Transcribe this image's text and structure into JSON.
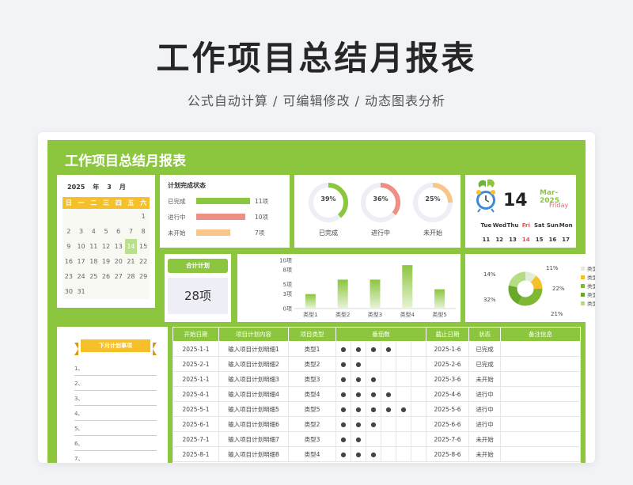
{
  "hero": {
    "title": "工作项目总结月报表",
    "subtitle": "公式自动计算 /  可编辑修改  / 动态图表分析"
  },
  "sheet_title": "工作项目总结月报表",
  "calendar": {
    "year": "2025",
    "year_unit": "年",
    "month": "3",
    "month_unit": "月",
    "weekdays": [
      "日",
      "一",
      "二",
      "三",
      "四",
      "五",
      "六"
    ],
    "days": [
      "",
      "",
      "",
      "",
      "",
      "",
      "1",
      "2",
      "3",
      "4",
      "5",
      "6",
      "7",
      "8",
      "9",
      "10",
      "11",
      "12",
      "13",
      "14",
      "15",
      "16",
      "17",
      "18",
      "19",
      "20",
      "21",
      "22",
      "23",
      "24",
      "25",
      "26",
      "27",
      "28",
      "29",
      "30",
      "31"
    ],
    "today": "14"
  },
  "plan_status": {
    "title": "计划完成状态",
    "rows": [
      {
        "label": "已完成",
        "count": "11项",
        "value": 11,
        "color": "#8cc63f"
      },
      {
        "label": "进行中",
        "count": "10项",
        "value": 10,
        "color": "#ee8f86"
      },
      {
        "label": "未开始",
        "count": "7项",
        "value": 7,
        "color": "#f8c68a"
      }
    ]
  },
  "donuts": [
    {
      "label": "已完成",
      "pct_text": "39%",
      "pct": 39,
      "color": "#8cc63f"
    },
    {
      "label": "进行中",
      "pct_text": "36%",
      "pct": 36,
      "color": "#ee8f86"
    },
    {
      "label": "未开始",
      "pct_text": "25%",
      "pct": 25,
      "color": "#f8c68a"
    }
  ],
  "date_widget": {
    "day": "14",
    "month_year": "Mar-2025",
    "weekday": "Friday",
    "week_names": [
      "Tue",
      "Wed",
      "Thu",
      "Fri",
      "Sat",
      "Sun",
      "Mon"
    ],
    "week_nums": [
      "11",
      "12",
      "13",
      "14",
      "15",
      "16",
      "17"
    ]
  },
  "total": {
    "label": "合计计划",
    "value": "28项"
  },
  "chart_data": [
    {
      "type": "bar",
      "categories": [
        "类型1",
        "类型2",
        "类型3",
        "类型4",
        "类型5"
      ],
      "values": [
        3,
        6,
        6,
        9,
        4
      ],
      "ylim": [
        0,
        10
      ],
      "yticks": [
        "0项",
        "3项",
        "5项",
        "8项",
        "10项"
      ],
      "ytick_values": [
        0,
        3,
        5,
        8,
        10
      ],
      "color": "#8cc63f"
    },
    {
      "type": "pie",
      "categories": [
        "类型1",
        "类型2",
        "类型3",
        "类型4",
        "类型5"
      ],
      "values": [
        11,
        14,
        32,
        21,
        22
      ],
      "labels": [
        "11%",
        "14%",
        "32%",
        "21%",
        "22%"
      ],
      "colors": [
        "#e2ecd6",
        "#f6c02a",
        "#7fb833",
        "#6aa82a",
        "#b4dc82"
      ]
    }
  ],
  "next_month": {
    "title": "下月计划事项",
    "items": [
      "1、",
      "2、",
      "3、",
      "4、",
      "5、",
      "6、",
      "7、"
    ]
  },
  "table": {
    "headers": [
      "开始日期",
      "项目计划内容",
      "项目类型",
      "番茄数",
      "截止日期",
      "状态",
      "备注信息"
    ],
    "rows": [
      {
        "start": "2025-1-1",
        "content": "输入项目计划明细1",
        "type": "类型1",
        "dots": 4,
        "end": "2025-1-6",
        "status": "已完成"
      },
      {
        "start": "2025-2-1",
        "content": "输入项目计划明细2",
        "type": "类型2",
        "dots": 2,
        "end": "2025-2-6",
        "status": "已完成"
      },
      {
        "start": "2025-1-1",
        "content": "输入项目计划明细3",
        "type": "类型3",
        "dots": 3,
        "end": "2025-3-6",
        "status": "未开始"
      },
      {
        "start": "2025-4-1",
        "content": "输入项目计划明细4",
        "type": "类型4",
        "dots": 4,
        "end": "2025-4-6",
        "status": "进行中"
      },
      {
        "start": "2025-5-1",
        "content": "输入项目计划明细5",
        "type": "类型5",
        "dots": 5,
        "end": "2025-5-6",
        "status": "进行中"
      },
      {
        "start": "2025-6-1",
        "content": "输入项目计划明细6",
        "type": "类型2",
        "dots": 3,
        "end": "2025-6-6",
        "status": "进行中"
      },
      {
        "start": "2025-7-1",
        "content": "输入项目计划明细7",
        "type": "类型3",
        "dots": 2,
        "end": "2025-7-6",
        "status": "未开始"
      },
      {
        "start": "2025-8-1",
        "content": "输入项目计划明细8",
        "type": "类型4",
        "dots": 3,
        "end": "2025-8-6",
        "status": "未开始"
      }
    ]
  }
}
